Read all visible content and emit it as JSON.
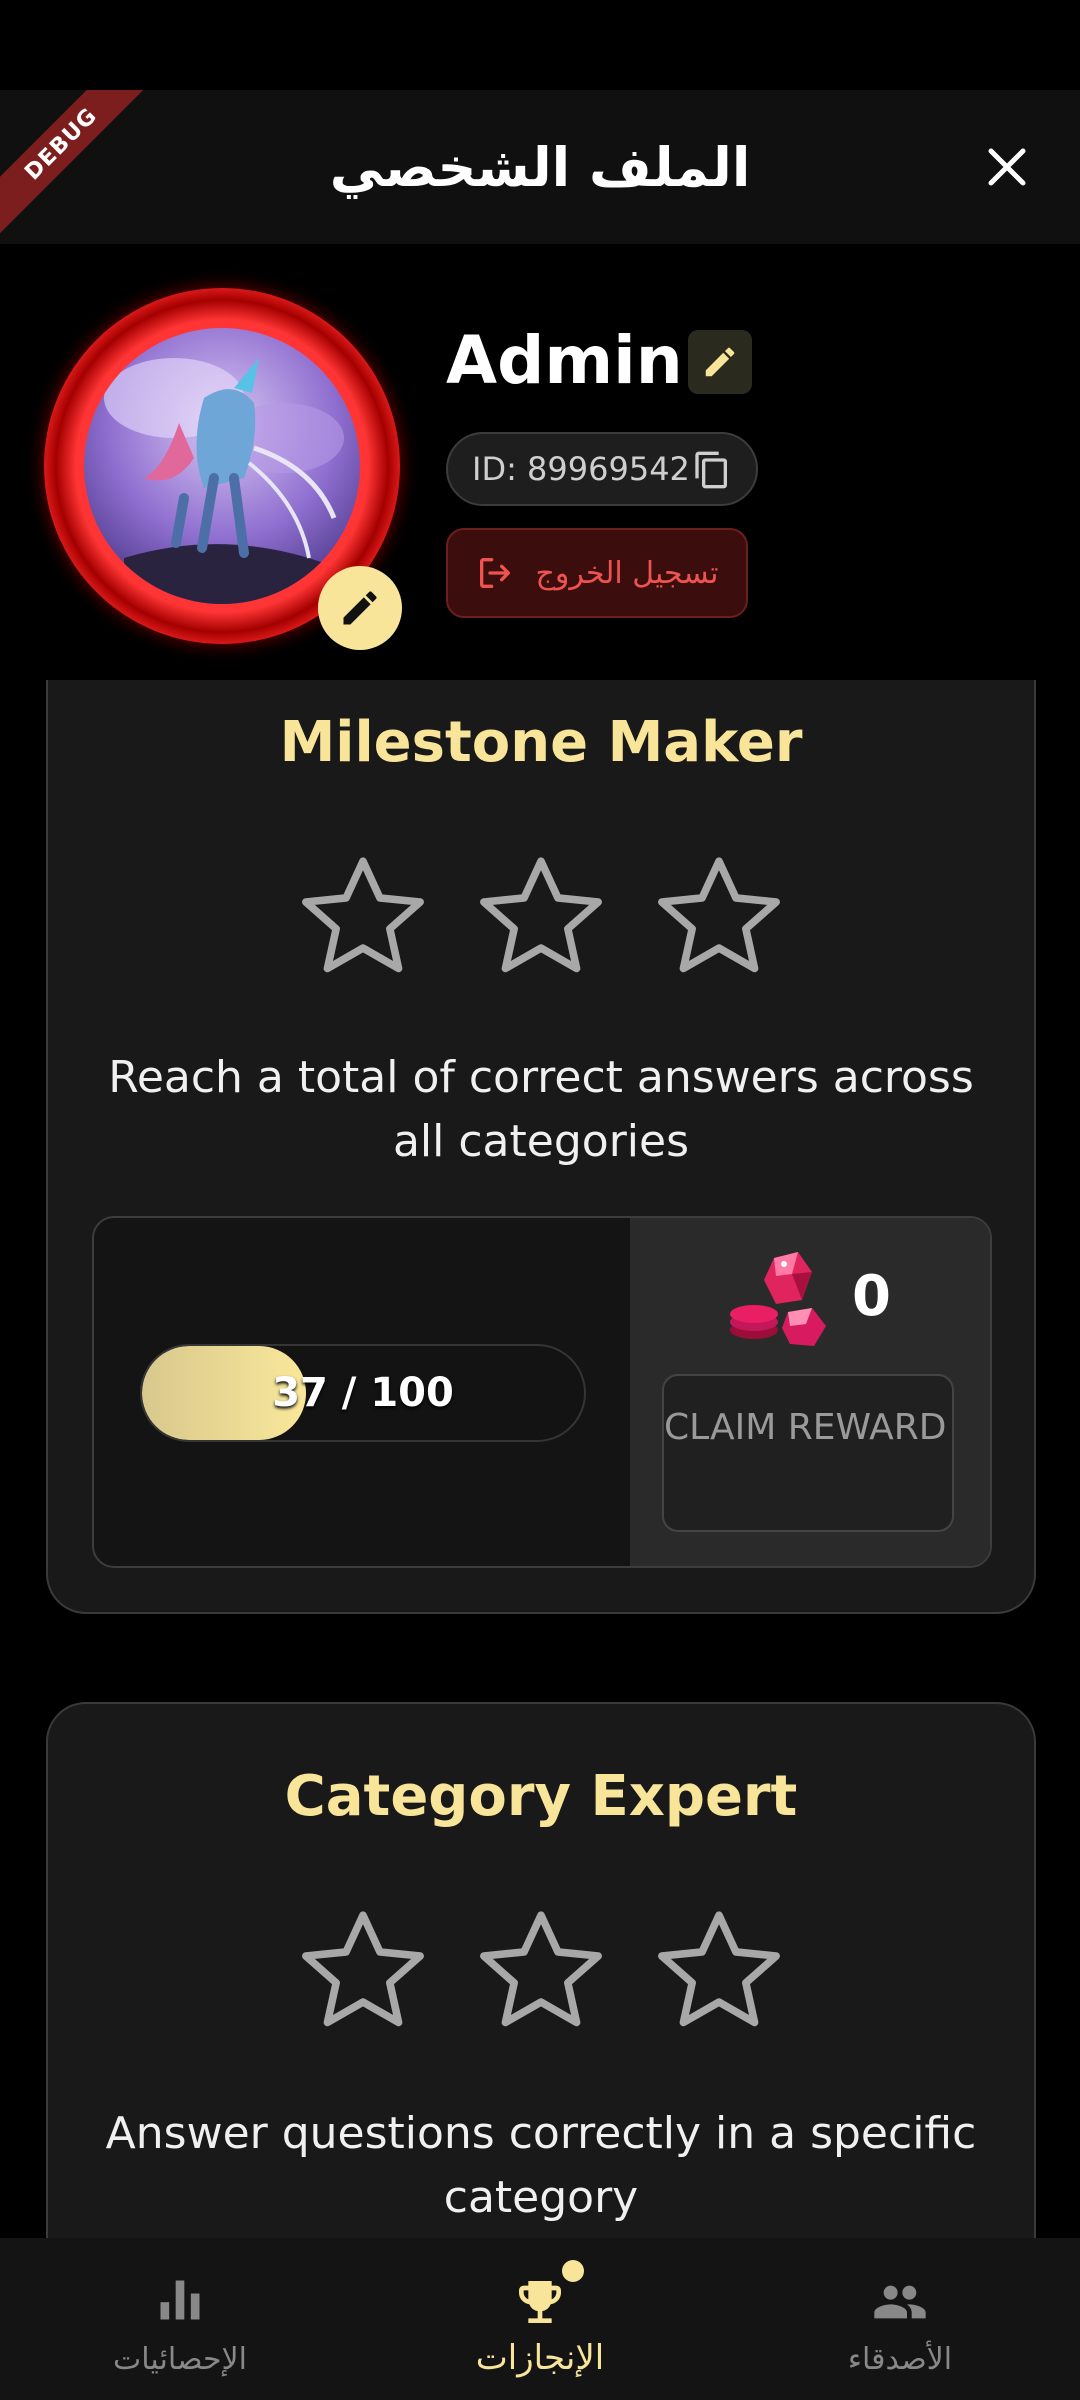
{
  "app_bar": {
    "title": "الملف الشخصي",
    "debug_label": "DEBUG"
  },
  "profile": {
    "username": "Admin",
    "id_text": "ID: 89969542",
    "logout_label": "تسجيل الخروج"
  },
  "achievements": [
    {
      "title": "Milestone Maker",
      "stars_earned": 0,
      "stars_total": 3,
      "description": "Reach a total of correct answers across all categories",
      "progress_current": 37,
      "progress_target": 100,
      "progress_label": "37 / 100",
      "reward_amount": "0",
      "claim_label": "CLAIM REWARD"
    },
    {
      "title": "Category Expert",
      "stars_earned": 0,
      "stars_total": 3,
      "description": "Answer questions correctly in a specific category"
    }
  ],
  "nav": {
    "items": [
      {
        "label": "الإحصائيات",
        "icon": "bar-chart-icon",
        "active": false
      },
      {
        "label": "الإنجازات",
        "icon": "trophy-icon",
        "active": true
      },
      {
        "label": "الأصدقاء",
        "icon": "people-icon",
        "active": false
      }
    ]
  },
  "colors": {
    "accent": "#f8e59a",
    "danger": "#ef5350",
    "card_bg": "#191919"
  }
}
